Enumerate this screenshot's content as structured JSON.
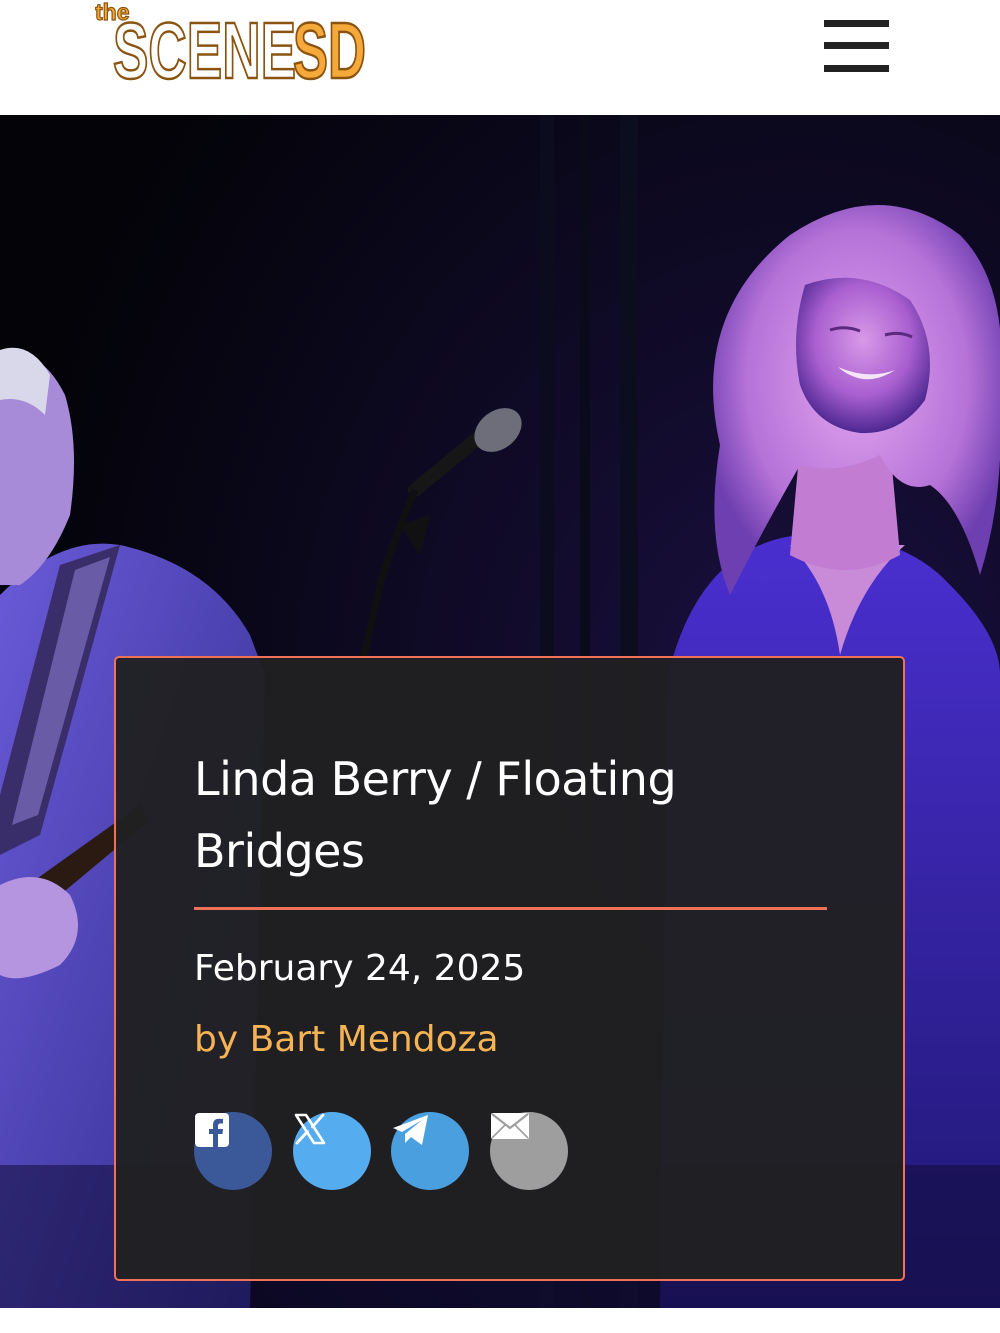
{
  "header": {
    "logo": {
      "small": "the",
      "main_a": "SCENE",
      "main_b": "SD"
    },
    "menu_icon": "hamburger-menu-icon"
  },
  "hero": {
    "image": "stage-photo-guitarist-and-singer-in-purple-light"
  },
  "article": {
    "title": "Linda Berry / Floating Bridges",
    "date": "February 24, 2025",
    "author": "by Bart Mendoza"
  },
  "share": [
    {
      "icon": "facebook-icon",
      "color": "#3b5998"
    },
    {
      "icon": "x-icon",
      "color": "#55acee"
    },
    {
      "icon": "telegram-icon",
      "color": "#4aa0df"
    },
    {
      "icon": "email-icon",
      "color": "#9e9e9e"
    }
  ],
  "colors": {
    "accent": "#f07157",
    "author": "#f5b354",
    "card_bg": "#202022",
    "logo_fill": "#ffffff",
    "logo_sd": "#f5a93a",
    "logo_outline": "#8a5410"
  }
}
